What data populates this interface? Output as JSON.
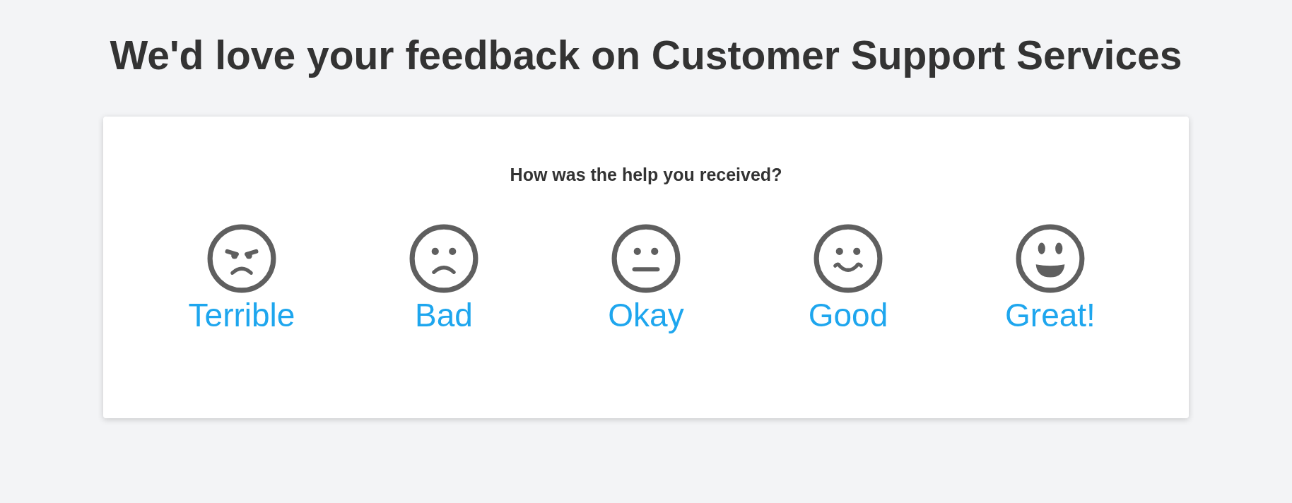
{
  "title": "We'd love your feedback on Customer Support Services",
  "question": "How was the help you received?",
  "options": [
    {
      "kind": "terrible",
      "label": "Terrible"
    },
    {
      "kind": "bad",
      "label": "Bad"
    },
    {
      "kind": "okay",
      "label": "Okay"
    },
    {
      "kind": "good",
      "label": "Good"
    },
    {
      "kind": "great",
      "label": "Great!"
    }
  ]
}
